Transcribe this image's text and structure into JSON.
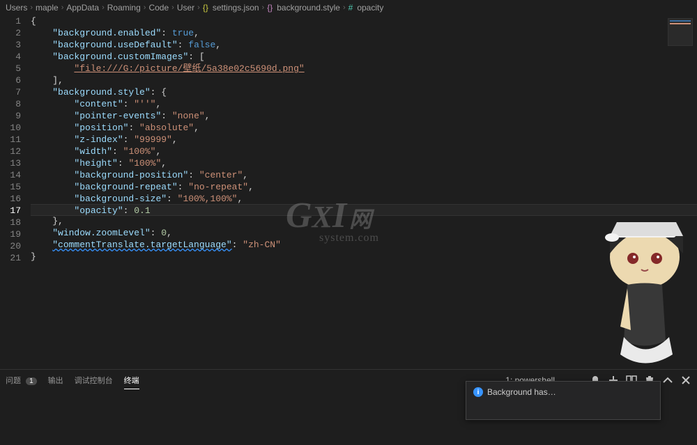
{
  "breadcrumb": {
    "items": [
      "Users",
      "maple",
      "AppData",
      "Roaming",
      "Code",
      "User"
    ],
    "file": "settings.json",
    "path1": "background.style",
    "path2": "opacity"
  },
  "lines": {
    "count": 21,
    "active": 17,
    "code": {
      "l2_key": "\"background.enabled\"",
      "l2_val": "true",
      "l3_key": "\"background.useDefault\"",
      "l3_val": "false",
      "l4_key": "\"background.customImages\"",
      "l5_url": "\"file:///G:/picture/壁纸/5a38e02c5690d.png\"",
      "l7_key": "\"background.style\"",
      "l8_key": "\"content\"",
      "l8_val": "\"''\"",
      "l9_key": "\"pointer-events\"",
      "l9_val": "\"none\"",
      "l10_key": "\"position\"",
      "l10_val": "\"absolute\"",
      "l11_key": "\"z-index\"",
      "l11_val": "\"99999\"",
      "l12_key": "\"width\"",
      "l12_val": "\"100%\"",
      "l13_key": "\"height\"",
      "l13_val": "\"100%\"",
      "l14_key": "\"background-position\"",
      "l14_val": "\"center\"",
      "l15_key": "\"background-repeat\"",
      "l15_val": "\"no-repeat\"",
      "l16_key": "\"background-size\"",
      "l16_val": "\"100%,100%\"",
      "l17_key": "\"opacity\"",
      "l17_val": "0.1",
      "l19_key": "\"window.zoomLevel\"",
      "l19_val": "0",
      "l20_key": "\"commentTranslate.targetLanguage\"",
      "l20_val": "\"zh-CN\""
    }
  },
  "panel": {
    "tabs": {
      "problems": "问题",
      "problems_count": "1",
      "output": "输出",
      "debug": "调试控制台",
      "terminal": "终端"
    },
    "terminal_dropdown": "1: powershell"
  },
  "notification": {
    "text": "Background has…"
  },
  "watermark": {
    "line1a": "G",
    "line1b": "X",
    "line1c": "I",
    "line1d": "网",
    "line2": "system.com"
  }
}
